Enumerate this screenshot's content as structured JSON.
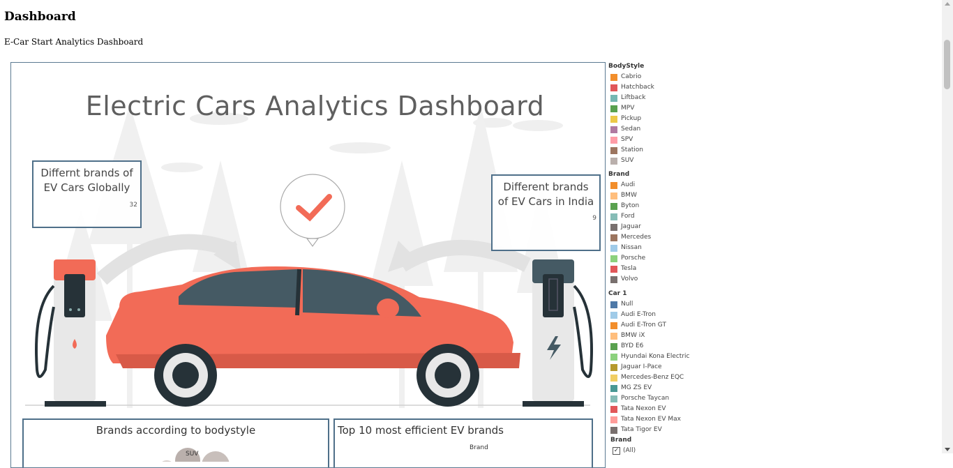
{
  "page": {
    "title": "Dashboard",
    "subtitle": "E-Car Start Analytics Dashboard"
  },
  "viz": {
    "title": "Electric Cars Analytics Dashboard",
    "kpi_global": {
      "label": "Differnt brands of EV Cars Globally",
      "value": "32"
    },
    "kpi_india": {
      "label": "Different brands of EV Cars in India",
      "value": "9"
    },
    "box_bodystyle": {
      "title": "Brands according to bodystyle",
      "bubble_label": "SUV"
    },
    "box_efficient": {
      "title": "Top 10 most efficient EV brands",
      "sub": "Brand"
    },
    "colors": {
      "car_body": "#f26b57",
      "window": "#455a64",
      "frame_border": "#5b7a91",
      "kpi_border": "#4e6f89"
    }
  },
  "legends": {
    "bodystyle": {
      "title": "BodyStyle",
      "items": [
        {
          "label": "Cabrio",
          "color": "#f28e2b"
        },
        {
          "label": "Hatchback",
          "color": "#e15759"
        },
        {
          "label": "Liftback",
          "color": "#76b7b2"
        },
        {
          "label": "MPV",
          "color": "#59a14f"
        },
        {
          "label": "Pickup",
          "color": "#edc948"
        },
        {
          "label": "Sedan",
          "color": "#b07aa1"
        },
        {
          "label": "SPV",
          "color": "#ff9da7"
        },
        {
          "label": "Station",
          "color": "#9c755f"
        },
        {
          "label": "SUV",
          "color": "#bab0ac"
        }
      ]
    },
    "brand": {
      "title": "Brand",
      "items": [
        {
          "label": "Audi",
          "color": "#f28e2b"
        },
        {
          "label": "BMW",
          "color": "#ffbe7d"
        },
        {
          "label": "Byton",
          "color": "#59a14f"
        },
        {
          "label": "Ford",
          "color": "#86bcb6"
        },
        {
          "label": "Jaguar",
          "color": "#79706e"
        },
        {
          "label": "Mercedes",
          "color": "#9c755f"
        },
        {
          "label": "Nissan",
          "color": "#a0cbe8"
        },
        {
          "label": "Porsche",
          "color": "#8cd17d"
        },
        {
          "label": "Tesla",
          "color": "#e15759"
        },
        {
          "label": "Volvo",
          "color": "#79706e"
        }
      ]
    },
    "car": {
      "title": "Car 1",
      "items": [
        {
          "label": "Null",
          "color": "#4e79a7"
        },
        {
          "label": "Audi E-Tron",
          "color": "#a0cbe8"
        },
        {
          "label": "Audi E-Tron GT",
          "color": "#f28e2b"
        },
        {
          "label": "BMW iX",
          "color": "#ffbe7d"
        },
        {
          "label": "BYD E6",
          "color": "#59a14f"
        },
        {
          "label": "Hyundai Kona Electric",
          "color": "#8cd17d"
        },
        {
          "label": "Jaguar I-Pace",
          "color": "#b6992d"
        },
        {
          "label": "Mercedes-Benz EQC",
          "color": "#f1ce63"
        },
        {
          "label": "MG ZS EV",
          "color": "#499894"
        },
        {
          "label": "Porsche Taycan",
          "color": "#86bcb6"
        },
        {
          "label": "Tata Nexon EV",
          "color": "#e15759"
        },
        {
          "label": "Tata Nexon EV Max",
          "color": "#ff9d9a"
        },
        {
          "label": "Tata Tigor EV",
          "color": "#79706e"
        }
      ]
    },
    "brand_filter": {
      "title": "Brand",
      "all_label": "(All)",
      "all_checked": true
    }
  }
}
